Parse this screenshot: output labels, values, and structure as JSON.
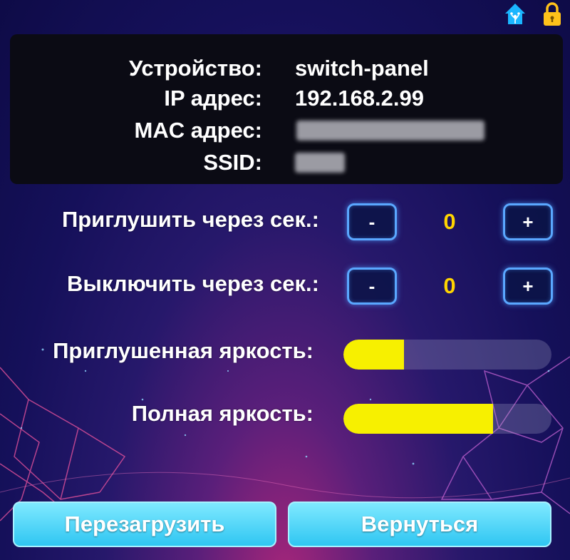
{
  "colors": {
    "panel_bg": "#0b0b14",
    "accent_blue": "#5aa7ff",
    "value_yellow": "#ffd400",
    "slider_fill": "#f7f000",
    "button_cyan": "#2fc6f2",
    "home_icon": "#1ab6ff",
    "lock_icon": "#ffc21a"
  },
  "top_icons": [
    "home-assistant-icon",
    "lock-icon"
  ],
  "info": {
    "device_label": "Устройство:",
    "device_value": "switch-panel",
    "ip_label": "IP адрес:",
    "ip_value": "192.168.2.99",
    "mac_label": "MAC адрес:",
    "ssid_label": "SSID:"
  },
  "controls": {
    "dim_after": {
      "label": "Приглушить через сек.:",
      "minus": "-",
      "value": "0",
      "plus": "+"
    },
    "off_after": {
      "label": "Выключить через сек.:",
      "minus": "-",
      "value": "0",
      "plus": "+"
    }
  },
  "sliders": {
    "dim_brightness": {
      "label": "Приглушенная яркость:",
      "level": 0.29
    },
    "full_brightness": {
      "label": "Полная яркость:",
      "level": 0.72
    }
  },
  "buttons": {
    "reboot": "Перезагрузить",
    "back": "Вернуться"
  }
}
